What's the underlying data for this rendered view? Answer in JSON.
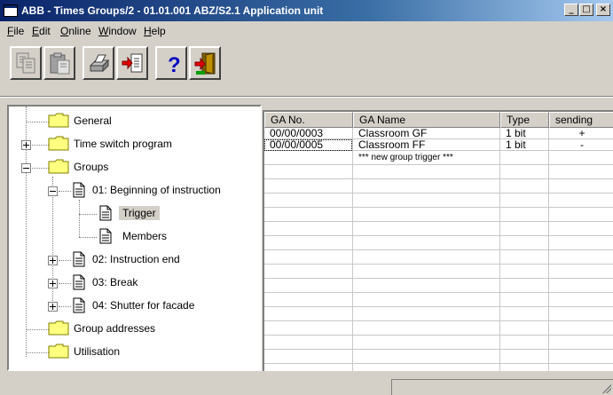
{
  "window": {
    "title": "ABB - Times Groups/2 - 01.01.001 ABZ/S2.1 Application unit",
    "controls": [
      "_",
      "□",
      "×"
    ]
  },
  "menu": [
    {
      "label": "File",
      "accel": "F",
      "rest": "ile"
    },
    {
      "label": "Edit",
      "accel": "E",
      "rest": "dit"
    },
    {
      "label": "Online",
      "accel": "O",
      "rest": "nline"
    },
    {
      "label": "Window",
      "accel": "W",
      "rest": "indow"
    },
    {
      "label": "Help",
      "accel": "H",
      "rest": "elp"
    }
  ],
  "toolbar": {
    "buttons": [
      "copy-icon",
      "paste-icon",
      "print-icon",
      "import-icon",
      "help-icon",
      "exit-icon"
    ],
    "help_glyph": "?"
  },
  "tree": {
    "items": [
      {
        "label": "General",
        "icon": "folder-icon"
      },
      {
        "label": "Time switch program",
        "icon": "folder-icon",
        "expander": "+"
      },
      {
        "label": "Groups",
        "icon": "folder-icon",
        "expander": "-"
      },
      {
        "label": "01: Beginning of instruction",
        "icon": "document-icon",
        "expander": "-"
      },
      {
        "label": "Trigger",
        "icon": "document-icon",
        "selected": true
      },
      {
        "label": "Members",
        "icon": "document-icon"
      },
      {
        "label": "02: Instruction end",
        "icon": "document-icon",
        "expander": "+"
      },
      {
        "label": "03: Break",
        "icon": "document-icon",
        "expander": "+"
      },
      {
        "label": "04: Shutter for facade",
        "icon": "document-icon",
        "expander": "+"
      },
      {
        "label": "Group addresses",
        "icon": "folder-icon"
      },
      {
        "label": "Utilisation",
        "icon": "folder-icon"
      }
    ]
  },
  "grid": {
    "columns": [
      "GA No.",
      "GA Name",
      "Type",
      "sending"
    ],
    "rows": [
      {
        "ga_no": "00/00/0003",
        "ga_name": "Classroom GF",
        "type": "1 bit",
        "sending": "+"
      },
      {
        "ga_no": "00/00/0005",
        "ga_name": "Classroom FF",
        "type": "1 bit",
        "sending": "-"
      },
      {
        "ga_no": "",
        "ga_name": "*** new group trigger ***",
        "type": "",
        "sending": ""
      }
    ]
  },
  "colors": {
    "title_gradient_start": "#0a246a",
    "title_gradient_end": "#a6caf0",
    "face": "#d4d0c8",
    "folder": "#ffff80"
  }
}
